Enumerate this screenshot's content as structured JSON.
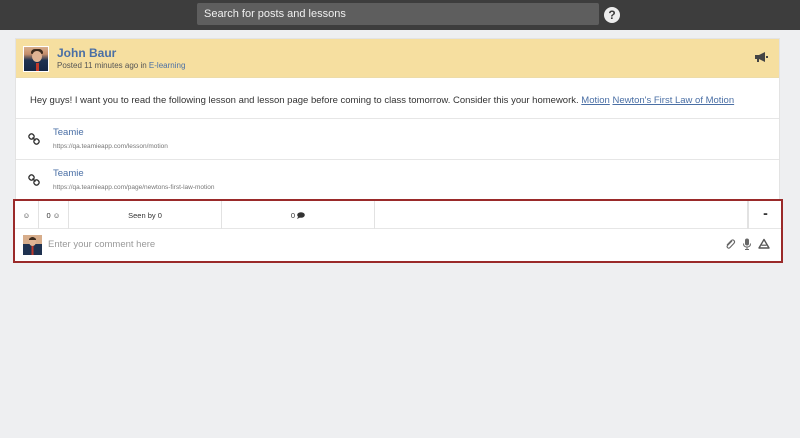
{
  "topbar": {
    "search_placeholder": "Search for posts and lessons",
    "help_label": "?"
  },
  "post": {
    "author": "John Baur",
    "posted_prefix": "Posted 11 minutes ago in ",
    "category": "E-learning",
    "body": "Hey guys! I want you to read the following lesson and lesson page before coming to class tomorrow. Consider this your homework.",
    "body_links": [
      "Motion",
      "Newton's First Law of Motion"
    ],
    "attachments": [
      {
        "title": "Teamie",
        "url": "https://qa.teamieapp.com/lesson/motion"
      },
      {
        "title": "Teamie",
        "url": "https://qa.teamieapp.com/page/newtons-first-law-motion"
      }
    ]
  },
  "actions": {
    "smiley_symbol": "☺",
    "reaction_count": "0 ☺",
    "seen_by": "Seen by 0",
    "comment_count": "0",
    "more": "•••",
    "comment_placeholder": "Enter your comment here"
  },
  "colors": {
    "topbar_bg": "#3d3d3d",
    "header_bg": "#f6dfa0",
    "link": "#4a6fa5",
    "highlight_border": "#9a2a2a"
  }
}
